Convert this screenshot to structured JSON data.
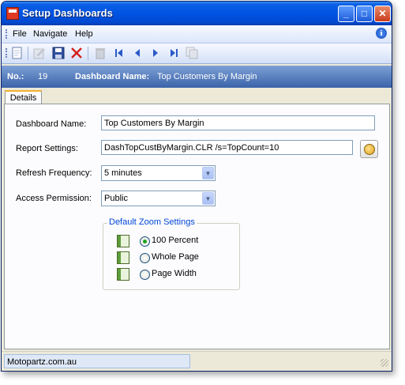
{
  "window": {
    "title": "Setup Dashboards"
  },
  "menu": {
    "items": [
      "File",
      "Navigate",
      "Help"
    ]
  },
  "toolbar": {
    "icons": [
      "new-icon",
      "edit-icon",
      "save-icon",
      "delete-x-icon",
      "trash-icon",
      "first-record-icon",
      "previous-record-icon",
      "next-record-icon",
      "last-record-icon",
      "copy-icon"
    ]
  },
  "header": {
    "no_label": "No.:",
    "no_value": "19",
    "name_label": "Dashboard Name:",
    "name_value": "Top Customers By Margin"
  },
  "tabs": [
    {
      "label": "Details",
      "selected": true
    }
  ],
  "form": {
    "dashboard_name": {
      "label": "Dashboard Name:",
      "value": "Top Customers By Margin"
    },
    "report_settings": {
      "label": "Report Settings:",
      "value": "DashTopCustByMargin.CLR /s=TopCount=10"
    },
    "refresh_frequency": {
      "label": "Refresh Frequency:",
      "value": "5 minutes"
    },
    "access_permission": {
      "label": "Access Permission:",
      "value": "Public"
    }
  },
  "zoom": {
    "title": "Default Zoom Settings",
    "options": [
      {
        "label": "100 Percent",
        "checked": true
      },
      {
        "label": "Whole Page",
        "checked": false
      },
      {
        "label": "Page Width",
        "checked": false
      }
    ]
  },
  "status": {
    "text": "Motopartz.com.au"
  },
  "colors": {
    "titlebar": "#0054e3",
    "header_band": "#3a63a8",
    "group_title": "#0046d5",
    "tab_accent": "#f5b030"
  }
}
